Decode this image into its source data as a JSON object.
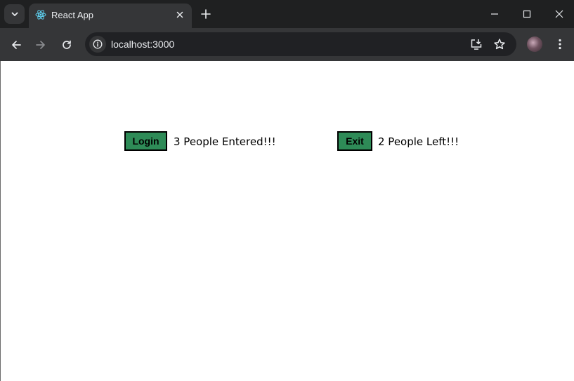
{
  "browser": {
    "tab": {
      "title": "React App",
      "favicon": "react-logo-icon"
    },
    "address": {
      "url": "localhost:3000"
    },
    "colors": {
      "frame": "#1f2021",
      "toolbar": "#353638",
      "omnibox": "#202124",
      "text": "#e8eaed"
    }
  },
  "app": {
    "login": {
      "button_label": "Login",
      "message": "3 People Entered!!!",
      "count": 3
    },
    "exit": {
      "button_label": "Exit",
      "message": "2 People Left!!!",
      "count": 2
    },
    "button_color": "#2e8b57"
  }
}
